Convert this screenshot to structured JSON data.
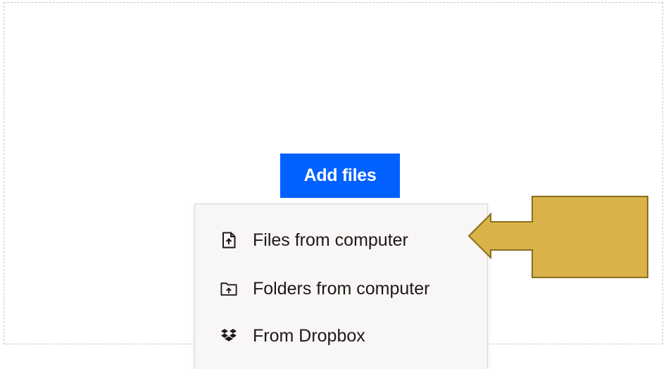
{
  "upload": {
    "add_files_label": "Add files"
  },
  "menu": {
    "items": [
      {
        "label": "Files from computer",
        "icon": "file-upload-icon"
      },
      {
        "label": "Folders from computer",
        "icon": "folder-upload-icon"
      },
      {
        "label": "From Dropbox",
        "icon": "dropbox-icon"
      }
    ]
  },
  "colors": {
    "button_blue": "#0061fe",
    "menu_bg": "#f8f7f5",
    "arrow_fill": "#d9b24a",
    "arrow_stroke": "#8a6e1c"
  }
}
